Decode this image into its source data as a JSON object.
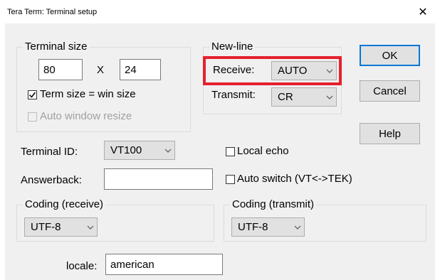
{
  "window": {
    "title": "Tera Term: Terminal setup",
    "close_glyph": "✕"
  },
  "terminal_size": {
    "legend": "Terminal size",
    "width_value": "80",
    "times_symbol": "X",
    "height_value": "24",
    "term_size_win_label": "Term size = win size",
    "term_size_win_checked": true,
    "auto_window_resize_label": "Auto window resize",
    "auto_window_resize_checked": false,
    "auto_window_resize_disabled": true
  },
  "new_line": {
    "legend": "New-line",
    "receive_label": "Receive:",
    "receive_value": "AUTO",
    "transmit_label": "Transmit:",
    "transmit_value": "CR",
    "highlight_color": "#e5202e"
  },
  "buttons": {
    "ok_label": "OK",
    "cancel_label": "Cancel",
    "help_label": "Help"
  },
  "terminal_id": {
    "label": "Terminal ID:",
    "value": "VT100"
  },
  "answerback": {
    "label": "Answerback:",
    "value": ""
  },
  "local_echo": {
    "label": "Local echo",
    "checked": false
  },
  "auto_switch": {
    "label": "Auto switch (VT<->TEK)",
    "checked": false
  },
  "coding_receive": {
    "legend": "Coding (receive)",
    "value": "UTF-8"
  },
  "coding_transmit": {
    "legend": "Coding (transmit)",
    "value": "UTF-8"
  },
  "locale": {
    "label": "locale:",
    "value": "american"
  },
  "icons": {
    "chevron": "chevron-down-icon",
    "check": "checkmark-icon"
  },
  "colors": {
    "accent": "#0078d7",
    "dialog_bg": "#f0f0f0"
  }
}
